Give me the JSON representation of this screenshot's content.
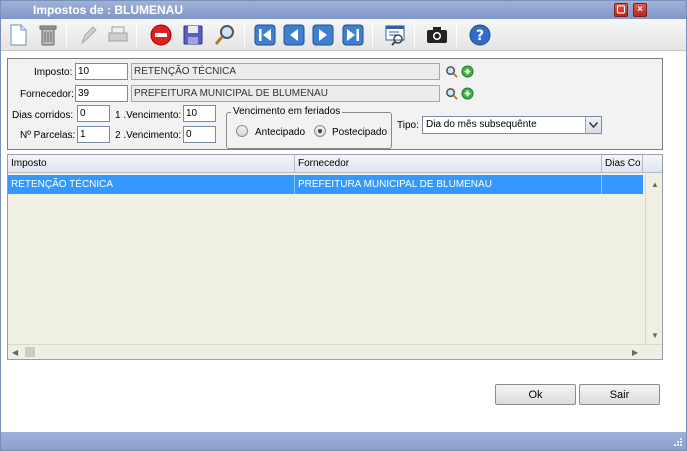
{
  "window": {
    "title": "Impostos de : BLUMENAU"
  },
  "toolbar": {
    "tools": [
      "new-icon",
      "delete-icon",
      "edit-icon",
      "print-icon",
      "cancel-icon",
      "save-icon",
      "search-icon",
      "first-icon",
      "previous-icon",
      "next-icon",
      "last-icon",
      "report-icon",
      "camera-icon",
      "help-icon"
    ]
  },
  "form": {
    "imposto_label": "Imposto:",
    "imposto_code": "10",
    "imposto_name": "RETENÇÃO TÉCNICA",
    "fornecedor_label": "Fornecedor:",
    "fornecedor_code": "39",
    "fornecedor_name": "PREFEITURA MUNICIPAL DE BLUMENAU",
    "dias_label": "Dias corridos:",
    "dias_value": "0",
    "venc1_label": "1 .Vencimento:",
    "venc1_value": "10",
    "parcelas_label": "Nº Parcelas:",
    "parcelas_value": "1",
    "venc2_label": "2 .Vencimento:",
    "venc2_value": "0",
    "feriados_legend": "Vencimento em feriados",
    "antecipado_label": "Antecipado",
    "postecipado_label": "Postecipado",
    "selected_feriado": "Postecipado",
    "tipo_label": "Tipo:",
    "tipo_value": "Dia do mês subsequênte"
  },
  "grid": {
    "columns": [
      "Imposto",
      "Fornecedor",
      "Dias Co"
    ],
    "rows": [
      {
        "imposto": "RETENÇÃO TÉCNICA",
        "fornecedor": "PREFEITURA MUNICIPAL DE BLUMENAU",
        "dias": ""
      }
    ]
  },
  "buttons": {
    "ok": "Ok",
    "sair": "Sair"
  },
  "colors": {
    "titlebar": "#8fa4d0",
    "selected_row": "#3399ff"
  }
}
